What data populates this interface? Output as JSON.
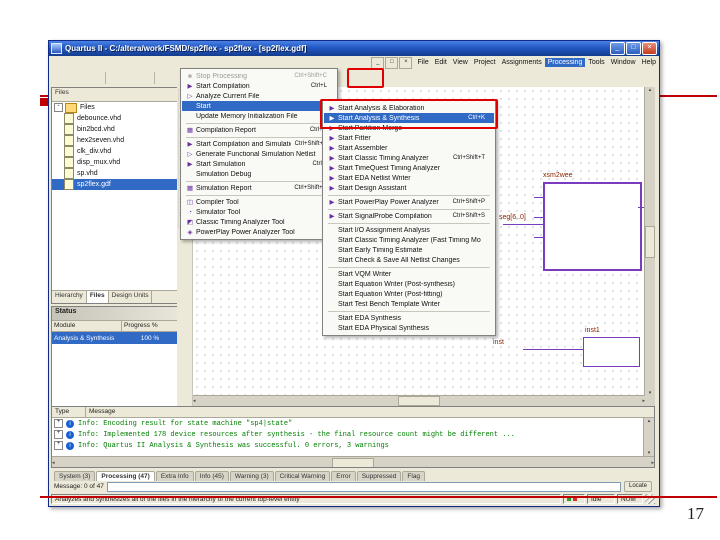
{
  "slide": {
    "page_number": "17"
  },
  "colors": {
    "accent_red": "#c00000",
    "selection_blue": "#316ac5",
    "info_green": "#008000"
  },
  "window": {
    "title": "Quartus II - C:/altera/work/FSMD/sp2flex - sp2flex - [sp2flex.gdf]",
    "controls": {
      "minimize": "_",
      "maximize": "□",
      "close": "×"
    }
  },
  "menu_bar": {
    "items": [
      {
        "label": "File"
      },
      {
        "label": "Edit"
      },
      {
        "label": "View"
      },
      {
        "label": "Project"
      },
      {
        "label": "Assignments"
      },
      {
        "label": "Processing",
        "cls": "act"
      },
      {
        "label": "Tools"
      },
      {
        "label": "Window"
      },
      {
        "label": "Help"
      }
    ]
  },
  "toolbar": {
    "left": [
      {
        "glyph": "▢",
        "name": "new-file-icon"
      },
      {
        "glyph": "▣",
        "name": "open-file-icon"
      },
      {
        "glyph": "▤",
        "name": "save-icon"
      },
      {
        "glyph": "▥",
        "name": "print-icon"
      },
      {
        "cls": "tsep",
        "name": "toolbar-separator"
      },
      {
        "glyph": "◆",
        "name": "cut-icon"
      },
      {
        "glyph": "◧",
        "name": "copy-icon"
      },
      {
        "glyph": "▨",
        "name": "paste-icon"
      },
      {
        "cls": "tsep",
        "name": "toolbar-separator"
      },
      {
        "glyph": "↶",
        "name": "undo-icon"
      },
      {
        "glyph": "↷",
        "name": "redo-icon"
      }
    ],
    "right": [
      {
        "glyph": "■",
        "name": "stop-processing-icon"
      },
      {
        "glyph": "▶",
        "name": "start-compilation-icon",
        "cls": "purple"
      },
      {
        "glyph": "▷",
        "name": "start-analysis-synthesis-icon",
        "cls": "purple"
      },
      {
        "glyph": "▦",
        "name": "compilation-report-icon"
      },
      {
        "glyph": "◔",
        "name": "timing-analyzer-icon"
      },
      {
        "glyph": "◫",
        "name": "assignment-editor-icon"
      },
      {
        "glyph": "▧",
        "name": "settings-icon"
      },
      {
        "glyph": "▶",
        "name": "start-simulation-icon",
        "cls": "blue"
      },
      {
        "glyph": "◈",
        "name": "programmer-icon"
      },
      {
        "glyph": "▩",
        "name": "chip-planner-icon"
      }
    ]
  },
  "vtoolbar": {
    "items": [
      {
        "glyph": "▸",
        "name": "select-tool-icon"
      },
      {
        "glyph": "A",
        "name": "text-tool-icon"
      },
      {
        "glyph": "◫",
        "name": "symbol-tool-icon"
      },
      {
        "glyph": "▭",
        "name": "block-tool-icon"
      },
      {
        "glyph": "╱",
        "name": "line-tool-icon"
      },
      {
        "glyph": "═",
        "name": "bus-tool-icon"
      },
      {
        "glyph": "─",
        "name": "node-tool-icon"
      },
      {
        "glyph": "▱",
        "name": "rect-tool-icon"
      },
      {
        "glyph": "◎",
        "name": "circle-tool-icon"
      },
      {
        "glyph": "◠",
        "name": "arc-tool-icon"
      }
    ]
  },
  "project_navigator": {
    "header": "Files",
    "files": [
      {
        "label": "Files",
        "cls": "root",
        "exp": "-"
      },
      {
        "label": "debounce.vhd",
        "cls": "child"
      },
      {
        "label": "bin2bcd.vhd",
        "cls": "child"
      },
      {
        "label": "hex2seven.vhd",
        "cls": "child"
      },
      {
        "label": "clk_div.vhd",
        "cls": "child"
      },
      {
        "label": "disp_mux.vhd",
        "cls": "child"
      },
      {
        "label": "sp.vhd",
        "cls": "child"
      },
      {
        "label": "sp2flex.gdf",
        "cls": "child sel"
      }
    ],
    "tabs": [
      {
        "label": "Hierarchy"
      },
      {
        "label": "Files",
        "cls": "act"
      },
      {
        "label": "Design Units"
      }
    ]
  },
  "status_panel": {
    "title": "Status",
    "columns": [
      "Module",
      "Progress %"
    ],
    "row": {
      "module": "Analysis & Synthesis",
      "progress": "100 %"
    }
  },
  "processing_menu": {
    "items": [
      {
        "label": "Stop Processing",
        "shortcut": "Ctrl+Shift+C",
        "glyph": "■",
        "icon": "stop-processing-icon",
        "cls": "disabled"
      },
      {
        "label": "Start Compilation",
        "shortcut": "Ctrl+L",
        "glyph": "▶",
        "icon": "start-compilation-icon"
      },
      {
        "label": "Analyze Current File",
        "glyph": "▷",
        "icon": "analyze-current-file-icon"
      },
      {
        "label": "Start",
        "arrow": "▶",
        "cls": "sel"
      },
      {
        "label": "Update Memory Initialization File"
      },
      {
        "cls": "sep"
      },
      {
        "label": "Compilation Report",
        "shortcut": "Ctrl+R",
        "glyph": "▦",
        "icon": "compilation-report-icon"
      },
      {
        "cls": "sep"
      },
      {
        "label": "Start Compilation and Simulation",
        "shortcut": "Ctrl+Shift+K",
        "glyph": "▶",
        "icon": "start-compilation-simulation-icon"
      },
      {
        "label": "Generate Functional Simulation Netlist",
        "glyph": "▷",
        "icon": "generate-functional-netlist-icon"
      },
      {
        "label": "Start Simulation",
        "shortcut": "Ctrl+I",
        "glyph": "▶",
        "icon": "start-simulation-icon"
      },
      {
        "label": "Simulation Debug",
        "arrow": "▶"
      },
      {
        "cls": "sep"
      },
      {
        "label": "Simulation Report",
        "shortcut": "Ctrl+Shift+R",
        "glyph": "▦",
        "icon": "simulation-report-icon"
      },
      {
        "cls": "sep"
      },
      {
        "label": "Compiler Tool",
        "glyph": "◫",
        "icon": "compiler-tool-icon"
      },
      {
        "label": "Simulator Tool",
        "glyph": "◔",
        "icon": "simulator-tool-icon"
      },
      {
        "label": "Classic Timing Analyzer Tool",
        "glyph": "◩",
        "icon": "timing-analyzer-tool-icon"
      },
      {
        "label": "PowerPlay Power Analyzer Tool",
        "glyph": "◈",
        "icon": "power-analyzer-tool-icon"
      }
    ]
  },
  "start_submenu": {
    "items": [
      {
        "label": "Start Analysis & Elaboration",
        "glyph": "▶",
        "icon": "start-analysis-elaboration-icon"
      },
      {
        "label": "Start Analysis & Synthesis",
        "shortcut": "Ctrl+K",
        "glyph": "▶",
        "icon": "start-analysis-synthesis-icon",
        "cls": "sel"
      },
      {
        "label": "Start Partition Merge",
        "glyph": "▶",
        "icon": "start-partition-merge-icon"
      },
      {
        "label": "Start Fitter",
        "glyph": "▶",
        "icon": "start-fitter-icon"
      },
      {
        "label": "Start Assembler",
        "glyph": "▶",
        "icon": "start-assembler-icon"
      },
      {
        "label": "Start Classic Timing Analyzer",
        "shortcut": "Ctrl+Shift+T",
        "glyph": "▶",
        "icon": "start-classic-timing-analyzer-icon"
      },
      {
        "label": "Start TimeQuest Timing Analyzer",
        "glyph": "▶",
        "icon": "start-timequest-analyzer-icon"
      },
      {
        "label": "Start EDA Netlist Writer",
        "glyph": "▶",
        "icon": "start-eda-netlist-writer-icon"
      },
      {
        "label": "Start Design Assistant",
        "glyph": "▶",
        "icon": "start-design-assistant-icon"
      },
      {
        "cls": "sep"
      },
      {
        "label": "Start PowerPlay Power Analyzer",
        "shortcut": "Ctrl+Shift+P",
        "glyph": "▶",
        "icon": "start-power-analyzer-icon"
      },
      {
        "cls": "sep"
      },
      {
        "label": "Start SignalProbe Compilation",
        "shortcut": "Ctrl+Shift+S",
        "glyph": "▶",
        "icon": "start-signalprobe-icon"
      },
      {
        "cls": "sep"
      },
      {
        "label": "Start I/O Assignment Analysis"
      },
      {
        "label": "Start Classic Timing Analyzer (Fast Timing Model)"
      },
      {
        "label": "Start Early Timing Estimate"
      },
      {
        "label": "Start Check & Save All Netlist Changes"
      },
      {
        "cls": "sep"
      },
      {
        "label": "Start VQM Writer"
      },
      {
        "label": "Start Equation Writer (Post-synthesis)"
      },
      {
        "label": "Start Equation Writer (Post-fitting)"
      },
      {
        "label": "Start Test Bench Template Writer"
      },
      {
        "cls": "sep"
      },
      {
        "label": "Start EDA Synthesis"
      },
      {
        "label": "Start EDA Physical Synthesis"
      }
    ]
  },
  "schematic": {
    "block_label": "xsm2wee",
    "bus_label": "seg[6..0]",
    "inst_label": "inst",
    "inst2_label": "inst1"
  },
  "messages": {
    "columns": [
      "Type",
      "Message"
    ],
    "expander_glyph": "+",
    "info_glyph": "i",
    "rows": [
      {
        "text": "Info: Encoding result for state machine \"sp4|state\""
      },
      {
        "text": "Info: Implemented 178 device resources after synthesis - the final resource count might be different ..."
      },
      {
        "text": "Info: Quartus II Analysis & Synthesis was successful. 0 errors, 3 warnings"
      }
    ],
    "tabs": [
      {
        "label": "System (3)"
      },
      {
        "label": "Processing (47)",
        "cls": "act"
      },
      {
        "label": "Extra Info"
      },
      {
        "label": "Info (45)"
      },
      {
        "label": "Warning (3)"
      },
      {
        "label": "Critical Warning"
      },
      {
        "label": "Error"
      },
      {
        "label": "Suppressed"
      },
      {
        "label": "Flag"
      }
    ],
    "counter": "Message: 0 of 47",
    "locate_label": "Locate"
  },
  "status_bar": {
    "text": "Analyzes and synthesizes all of the files in the hierarchy of the current top-level entity",
    "mode": "Idle",
    "num_lock": "NUM"
  }
}
